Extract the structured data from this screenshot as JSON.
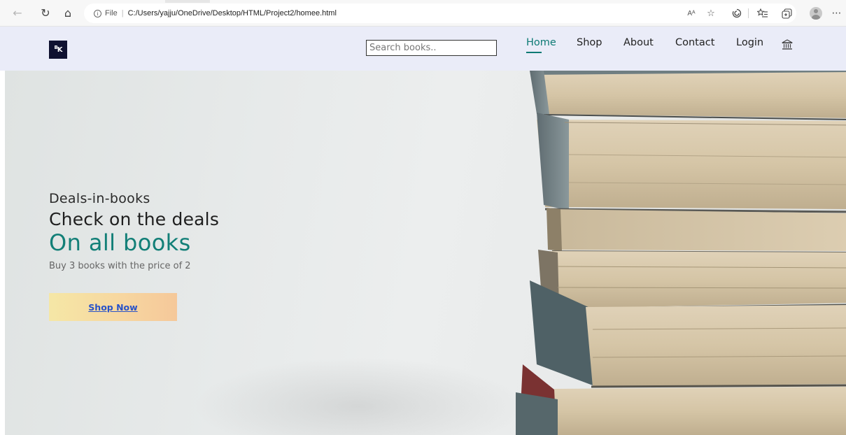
{
  "browser": {
    "address": {
      "scheme": "File",
      "separator": "|",
      "url": "C:/Users/yajju/OneDrive/Desktop/HTML/Project2/homee.html"
    },
    "read_aloud": "Aᴬ",
    "icons": [
      "back-arrow-icon",
      "reload-icon",
      "home-icon",
      "info-icon",
      "read-aloud-icon",
      "favorite-add-icon",
      "browser-essentials-icon",
      "favorites-icon",
      "collections-icon",
      "profile-icon",
      "more-icon"
    ]
  },
  "site": {
    "logo": {
      "main": "K",
      "sup": "B"
    },
    "search": {
      "placeholder": "Search books.."
    },
    "nav": {
      "home": "Home",
      "shop": "Shop",
      "about": "About",
      "contact": "Contact",
      "login": "Login"
    },
    "colors": {
      "nav_bg": "#eaecf8",
      "accent": "#0d7a74",
      "logo_bg": "#0f1130",
      "cta_link": "#2953c8"
    }
  },
  "hero": {
    "eyebrow": "Deals-in-books",
    "headline": "Check on the deals",
    "accent": "On all books",
    "offer": "Buy 3 books with the price of 2",
    "cta": "Shop Now"
  }
}
